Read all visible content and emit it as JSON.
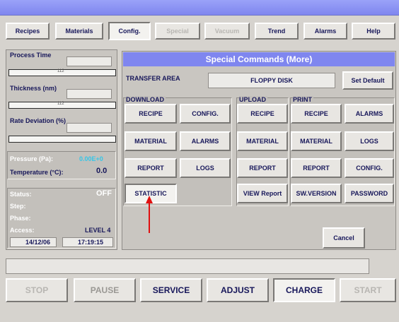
{
  "menu": {
    "recipes": "Recipes",
    "materials": "Materials",
    "config": "Config.",
    "special": "Special",
    "vacuum": "Vacuum",
    "trend": "Trend",
    "alarms": "Alarms",
    "help": "Help"
  },
  "left": {
    "process_time_label": "Process Time",
    "gauge1_tick": "112",
    "thickness_label": "Thickness (nm)",
    "gauge2_tick": "112",
    "rate_label": "Rate Deviation (%)",
    "pressure_label": "Pressure (Pa):",
    "pressure_value": "0.00E+0",
    "temperature_label": "Temperature (°C):",
    "temperature_value": "0.0",
    "status_label": "Status:",
    "status_value": "OFF",
    "step_label": "Step:",
    "phase_label": "Phase:",
    "access_label": "Access:",
    "access_value": "LEVEL 4",
    "date": "14/12/06",
    "time": "17:19:15"
  },
  "special": {
    "title": "Special Commands (More)",
    "transfer_area_label": "TRANSFER AREA",
    "transfer_area_value": "FLOPPY DISK",
    "set_default": "Set Default",
    "download_label": "DOWNLOAD",
    "upload_label": "UPLOAD",
    "print_label": "PRINT",
    "download_buttons": [
      "RECIPE",
      "CONFIG.",
      "MATERIAL",
      "ALARMS",
      "REPORT",
      "LOGS",
      "STATISTIC"
    ],
    "upload_buttons": [
      "RECIPE",
      "MATERIAL",
      "REPORT"
    ],
    "print_buttons": [
      "RECIPE",
      "ALARMS",
      "MATERIAL",
      "LOGS",
      "REPORT",
      "CONFIG."
    ],
    "view_report": "VIEW Report",
    "sw_version": "SW.VERSION",
    "password": "PASSWORD",
    "cancel": "Cancel"
  },
  "bottom": {
    "stop": "STOP",
    "pause": "PAUSE",
    "service": "SERVICE",
    "adjust": "ADJUST",
    "charge": "CHARGE",
    "start": "START"
  },
  "colors": {
    "title_bar": "#7f86ef",
    "label_blue": "#17175a",
    "pressure_value": "#35c6e8",
    "arrow": "#e01010"
  }
}
